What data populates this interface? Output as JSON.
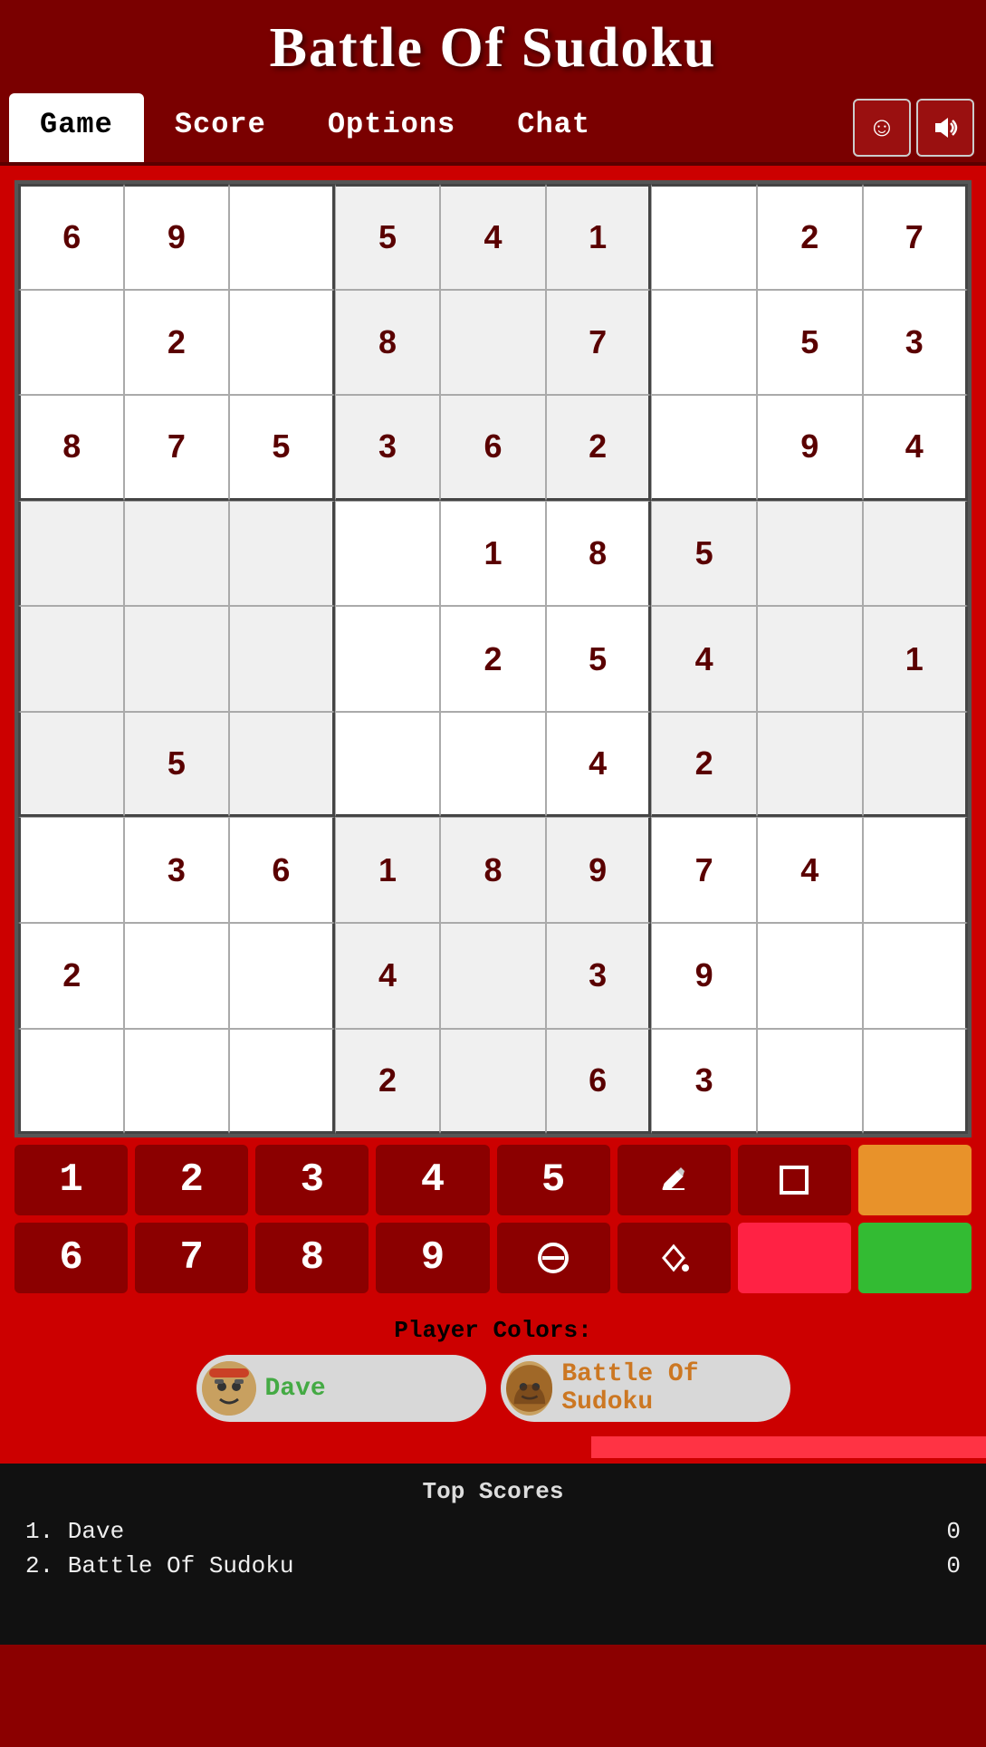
{
  "app": {
    "title": "Battle Of Sudoku"
  },
  "nav": {
    "tabs": [
      {
        "id": "game",
        "label": "Game",
        "active": true
      },
      {
        "id": "score",
        "label": "Score",
        "active": false
      },
      {
        "id": "options",
        "label": "Options",
        "active": false
      },
      {
        "id": "chat",
        "label": "Chat",
        "active": false
      }
    ],
    "smiley_icon": "☺",
    "sound_icon": "🔊"
  },
  "grid": {
    "cells": [
      [
        "6",
        "9",
        "",
        "5",
        "4",
        "1",
        "",
        "2",
        "7"
      ],
      [
        "",
        "2",
        "",
        "8",
        "",
        "7",
        "",
        "5",
        "3"
      ],
      [
        "8",
        "7",
        "5",
        "3",
        "6",
        "2",
        "",
        "9",
        "4"
      ],
      [
        "",
        "",
        "",
        "",
        "1",
        "8",
        "5",
        "",
        ""
      ],
      [
        "",
        "",
        "",
        "",
        "2",
        "5",
        "4",
        "",
        "1"
      ],
      [
        "",
        "5",
        "",
        "",
        "",
        "4",
        "2",
        "",
        ""
      ],
      [
        "",
        "3",
        "6",
        "1",
        "8",
        "9",
        "7",
        "4",
        ""
      ],
      [
        "2",
        "",
        "",
        "4",
        "",
        "3",
        "9",
        "",
        ""
      ],
      [
        "",
        "",
        "",
        "2",
        "",
        "6",
        "3",
        "",
        ""
      ]
    ]
  },
  "controls": {
    "row1": [
      "1",
      "2",
      "3",
      "4",
      "5"
    ],
    "row2": [
      "6",
      "7",
      "8",
      "9"
    ],
    "pencil_label": "✏",
    "square_label": "□",
    "no_entry_label": "⊘",
    "diamond_label": "◇",
    "color_orange": "#e8922a",
    "color_black": "#111111",
    "color_green": "#33bb33",
    "color_red": "#ff2244"
  },
  "player_colors": {
    "title": "Player Colors:",
    "players": [
      {
        "name": "Dave",
        "color": "green",
        "avatar": "😎"
      },
      {
        "name": "Battle Of Sudoku",
        "color": "orange",
        "avatar": "🤠"
      }
    ]
  },
  "scores": {
    "title": "Top Scores",
    "entries": [
      {
        "rank": "1.",
        "name": "Dave",
        "score": "0"
      },
      {
        "rank": "2.",
        "name": "Battle Of Sudoku",
        "score": "0"
      }
    ]
  }
}
